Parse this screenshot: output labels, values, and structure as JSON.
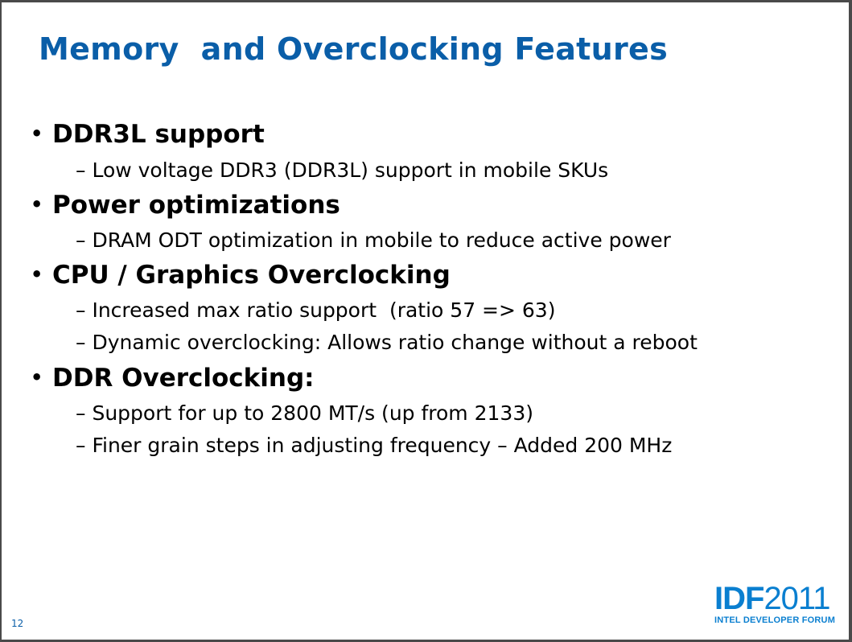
{
  "title": "Memory  and Overclocking Features",
  "bullets": [
    {
      "heading": "DDR3L support",
      "subs": [
        "Low voltage DDR3 (DDR3L) support in mobile SKUs"
      ]
    },
    {
      "heading": "Power optimizations",
      "subs": [
        "DRAM ODT optimization in mobile to reduce active power"
      ]
    },
    {
      "heading": "CPU / Graphics Overclocking",
      "subs": [
        "Increased max ratio support  (ratio 57 => 63)",
        "Dynamic overclocking: Allows ratio change without a reboot"
      ]
    },
    {
      "heading": "DDR Overclocking:",
      "subs": [
        "Support for up to 2800 MT/s (up from 2133)",
        "Finer grain steps in adjusting frequency – Added 200 MHz"
      ]
    }
  ],
  "bullet_char": "•",
  "dash_char": "–",
  "page_number": "12",
  "logo": {
    "idf": "IDF",
    "year": "2011",
    "tagline": "INTEL DEVELOPER FORUM"
  }
}
